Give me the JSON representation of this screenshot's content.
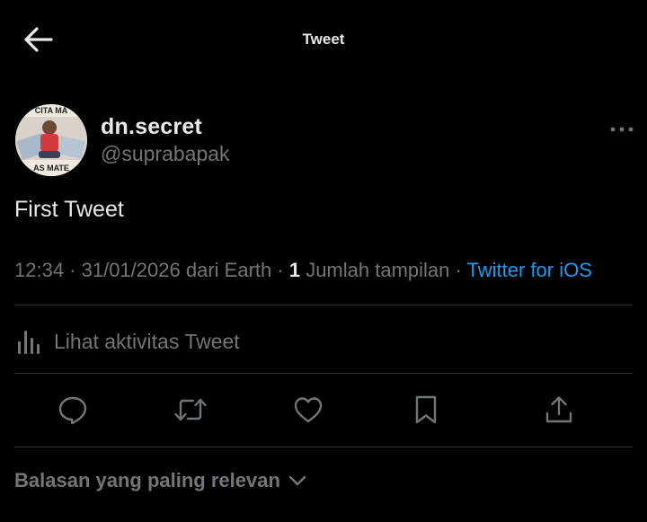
{
  "header": {
    "title": "Tweet",
    "back_icon": "arrow-left-icon"
  },
  "author": {
    "display_name": "dn.secret",
    "handle": "@suprabapak",
    "avatar_text_top": "CITA MA",
    "avatar_text_bottom": "AS MATE"
  },
  "tweet": {
    "text": "First Tweet",
    "time": "12:34",
    "date": "31/01/2026",
    "source_prefix": "dari Earth",
    "view_count": "1",
    "views_label": "Jumlah tampilan",
    "client": "Twitter for iOS"
  },
  "activity": {
    "label": "Lihat aktivitas Tweet",
    "icon": "analytics-icon"
  },
  "actions": [
    {
      "name": "reply",
      "icon": "reply-icon"
    },
    {
      "name": "retweet",
      "icon": "retweet-icon"
    },
    {
      "name": "like",
      "icon": "heart-icon"
    },
    {
      "name": "bookmark",
      "icon": "bookmark-icon"
    },
    {
      "name": "share",
      "icon": "share-icon"
    }
  ],
  "replies": {
    "sort_label": "Balasan yang paling relevan"
  },
  "colors": {
    "background": "#000000",
    "primary_text": "#e7e9ea",
    "secondary_text": "#71767b",
    "link": "#1d9bf0",
    "divider": "#2f3336"
  }
}
